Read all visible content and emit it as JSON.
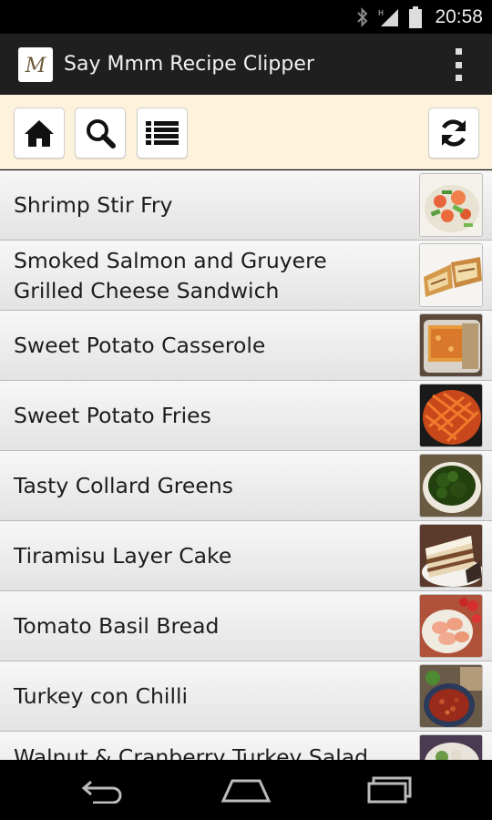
{
  "status_bar": {
    "time": "20:58",
    "icons": [
      "bluetooth-icon",
      "signal-icon",
      "battery-icon"
    ]
  },
  "action_bar": {
    "app_icon_letter": "M",
    "title": "Say Mmm Recipe Clipper",
    "menu_icon": "overflow-menu-icon"
  },
  "toolbar": {
    "buttons": [
      "home-icon",
      "search-icon",
      "list-icon",
      "refresh-icon"
    ]
  },
  "recipes": [
    {
      "title": "Shrimp Stir Fry",
      "thumb": "shrimp-stir-fry-photo"
    },
    {
      "title": "Smoked Salmon and Gruyere Grilled Cheese Sandwich",
      "thumb": "grilled-cheese-photo"
    },
    {
      "title": "Sweet Potato Casserole",
      "thumb": "casserole-photo"
    },
    {
      "title": "Sweet Potato Fries",
      "thumb": "fries-photo"
    },
    {
      "title": "Tasty Collard Greens",
      "thumb": "collard-greens-photo"
    },
    {
      "title": "Tiramisu Layer Cake",
      "thumb": "cake-photo"
    },
    {
      "title": "Tomato Basil Bread",
      "thumb": "bread-photo"
    },
    {
      "title": "Turkey con Chilli",
      "thumb": "chili-photo"
    },
    {
      "title": "Walnut & Cranberry Turkey Salad",
      "thumb": "salad-photo"
    }
  ],
  "nav_bar": {
    "buttons": [
      "back-icon",
      "home-nav-icon",
      "recents-icon"
    ]
  }
}
